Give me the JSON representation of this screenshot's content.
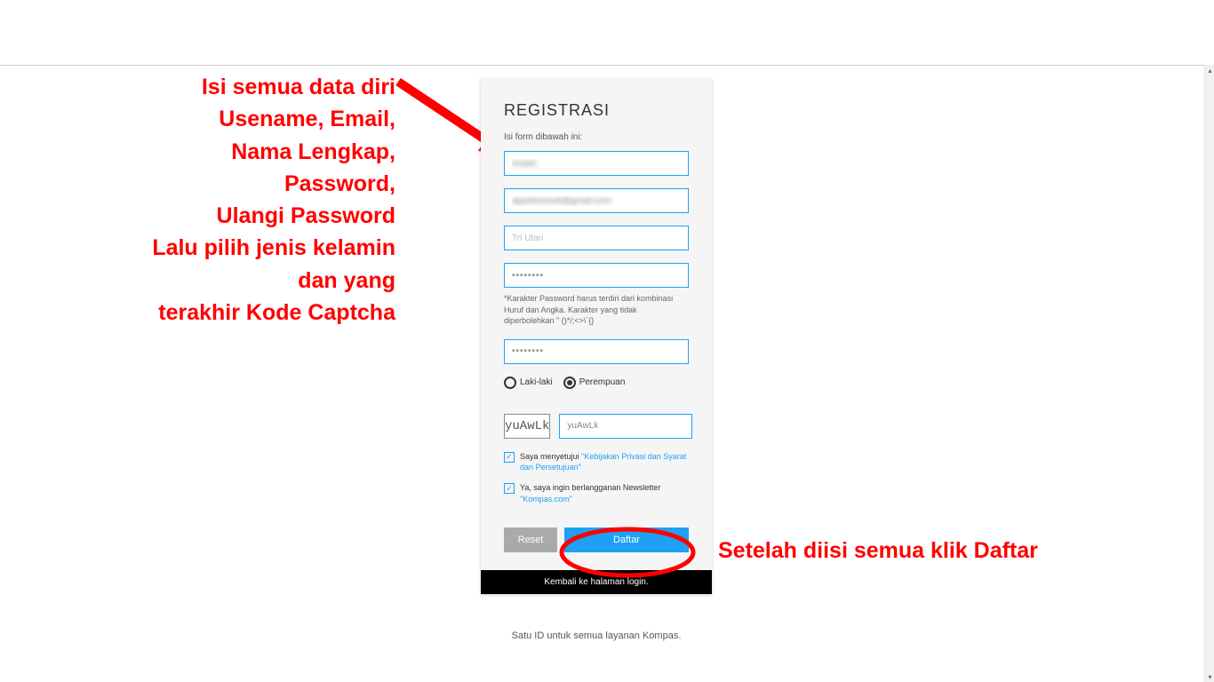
{
  "annotations": {
    "left": {
      "l1": "Isi semua data diri",
      "l2": "Usename, Email,",
      "l3": "Nama Lengkap,",
      "l4": "Password,",
      "l5": "Ulangi Password",
      "l6": "Lalu pilih jenis kelamin",
      "l7": "dan yang",
      "l8": "terakhir Kode Captcha"
    },
    "right": "Setelah diisi semua klik Daftar"
  },
  "form": {
    "title": "REGISTRASI",
    "help": "Isi form dibawah ini:",
    "username": "triutari",
    "email": "ajaufansclub@gmail.com",
    "fullname": "Tri Utari",
    "password": "••••••••",
    "repeat_password": "••••••••",
    "password_hint": "*Karakter Password harus terdiri dari kombinasi Huruf dan Angka. Karakter yang tidak diperbolehkan \" ()*/;<>\\`{}",
    "gender": {
      "male": "Laki-laki",
      "female": "Perempuan"
    },
    "captcha_code": "yuAwLk",
    "captcha_value": "yuAwLk",
    "agree1_a": "Saya menyetujui ",
    "agree1_b": "\"Kebijakan Privasi dan Syarat dan Persetujuan\"",
    "agree2_a": "Ya, saya ingin berlangganan Newsletter ",
    "agree2_b": "\"Kompas.com\"",
    "reset": "Reset",
    "submit": "Daftar",
    "footer": "Kembali ke halaman login."
  },
  "footnote": "Satu ID untuk semua layanan Kompas."
}
